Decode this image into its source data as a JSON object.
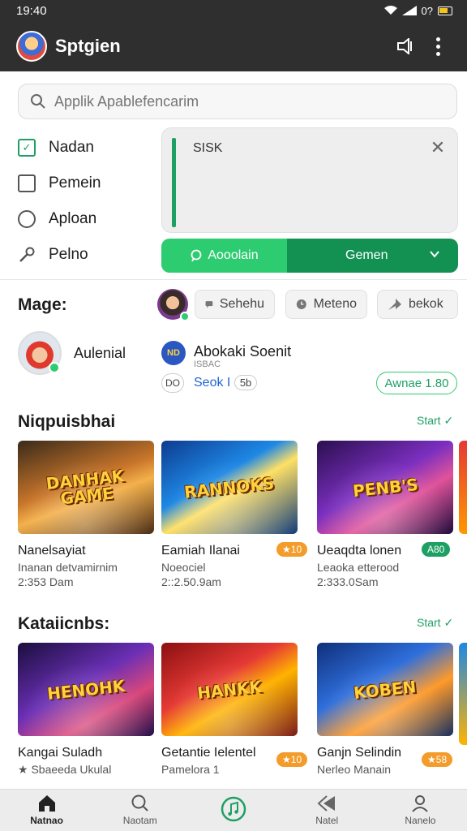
{
  "status_bar": {
    "time": "19:40",
    "battery_text": "0?"
  },
  "app_bar": {
    "title": "Sptgien"
  },
  "search": {
    "placeholder": "Applik Apablefencarim"
  },
  "options": [
    {
      "label": "Nadan",
      "state": "checked"
    },
    {
      "label": "Pemein",
      "state": "unchecked"
    },
    {
      "label": "Aploan",
      "state": "radio"
    },
    {
      "label": "Pelno",
      "state": "tool"
    }
  ],
  "text_panel": {
    "text": "SISK"
  },
  "actions": {
    "primary": "Aooolain",
    "secondary": "Gemen"
  },
  "mage": {
    "label": "Mage:",
    "chips": [
      {
        "label": "Sehehu",
        "icon": "chat-icon"
      },
      {
        "label": "Meteno",
        "icon": "clock-icon"
      },
      {
        "label": "bekok",
        "icon": "share-icon"
      }
    ]
  },
  "user": {
    "name": "Aulenial"
  },
  "publisher": {
    "name": "Abokaki Soenit",
    "sub": "ISBAC",
    "badge": "DO",
    "stat_text": "Seok I",
    "stat_pill": "5b",
    "install_label": "Awnae 1.80"
  },
  "sections": [
    {
      "title": "Niqpuisbhai",
      "link": "Start",
      "cards": [
        {
          "thumb_text": "DANHAK GAME",
          "title": "Nanelsayiat",
          "sub": "Inanan detvamirnim",
          "meta": "2:353 Dam",
          "badge": ""
        },
        {
          "thumb_text": "RANNOKS",
          "title": "Eamiah Ilanai",
          "sub": "Noeociel",
          "meta": "2::2.50.9am",
          "badge": "10"
        },
        {
          "thumb_text": "PENB'S",
          "title": "Ueaqdta lonen",
          "sub": "Leaoka etterood",
          "meta": "2:333.0Sam",
          "badge": "A80"
        }
      ]
    },
    {
      "title": "Kataiicnbs:",
      "link": "Start",
      "cards": [
        {
          "thumb_text": "HENOHK",
          "title": "Kangai Suladh",
          "sub": "Sbaeeda Ukulal",
          "meta": "",
          "badge": ""
        },
        {
          "thumb_text": "HANKK",
          "title": "Getantie Ielentel",
          "sub": "Pamelora 1",
          "meta": "",
          "badge": "10"
        },
        {
          "thumb_text": "KOBEN",
          "title": "Ganjn Selindin",
          "sub": "Nerleo Manain",
          "meta": "",
          "badge": "58"
        }
      ]
    }
  ],
  "bottom_nav": [
    {
      "label": "Natnao",
      "icon": "home-icon"
    },
    {
      "label": "Naotam",
      "icon": "search-icon"
    },
    {
      "label": "",
      "icon": "music-icon"
    },
    {
      "label": "Natel",
      "icon": "back-icon"
    },
    {
      "label": "Nanelo",
      "icon": "profile-icon"
    }
  ],
  "colors": {
    "accent": "#1ea064",
    "accent_light": "#2ecc71",
    "app_bar": "#2f2f2f",
    "badge_orange": "#f39c2b"
  }
}
